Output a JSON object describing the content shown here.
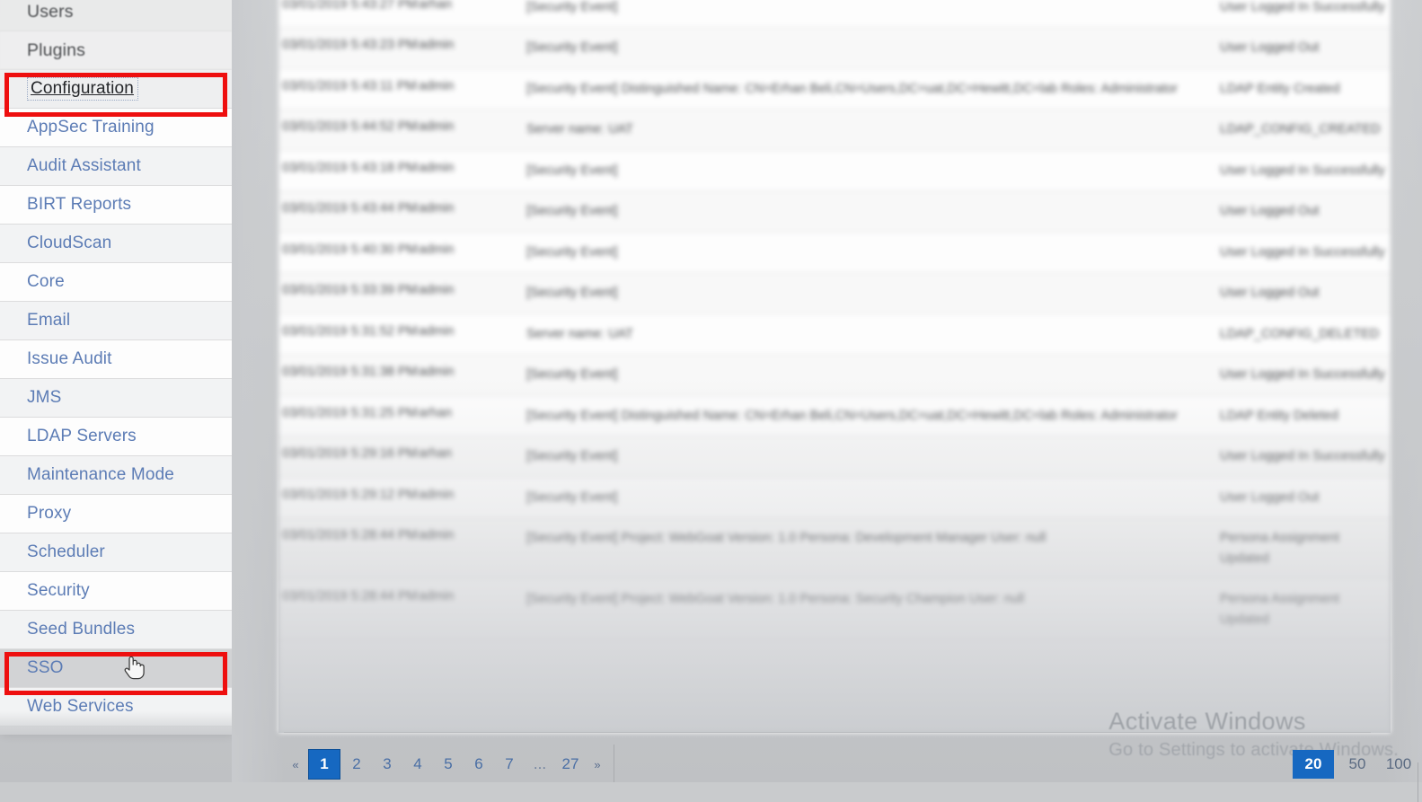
{
  "sidebar": {
    "items": [
      {
        "label": "Users",
        "kind": "header"
      },
      {
        "label": "Plugins",
        "kind": "header"
      },
      {
        "label": "Configuration",
        "kind": "current"
      },
      {
        "label": "AppSec Training",
        "kind": "link"
      },
      {
        "label": "Audit Assistant",
        "kind": "link"
      },
      {
        "label": "BIRT Reports",
        "kind": "link"
      },
      {
        "label": "CloudScan",
        "kind": "link"
      },
      {
        "label": "Core",
        "kind": "link"
      },
      {
        "label": "Email",
        "kind": "link"
      },
      {
        "label": "Issue Audit",
        "kind": "link"
      },
      {
        "label": "JMS",
        "kind": "link"
      },
      {
        "label": "LDAP Servers",
        "kind": "link"
      },
      {
        "label": "Maintenance Mode",
        "kind": "link"
      },
      {
        "label": "Proxy",
        "kind": "link"
      },
      {
        "label": "Scheduler",
        "kind": "link"
      },
      {
        "label": "Security",
        "kind": "link"
      },
      {
        "label": "Seed Bundles",
        "kind": "link"
      },
      {
        "label": "SSO",
        "kind": "hovered"
      },
      {
        "label": "Web Services",
        "kind": "link"
      }
    ]
  },
  "annotations": {
    "highlight_color": "#ee0f0f",
    "boxes": [
      "Configuration",
      "SSO"
    ]
  },
  "audit_table": {
    "rows": [
      {
        "date": "03/01/2019 5:43:27 PM",
        "user": "arhan",
        "description": "[Security Event]",
        "type": "User Logged In Successfully"
      },
      {
        "date": "03/01/2019 5:43:23 PM",
        "user": "admin",
        "description": "[Security Event]",
        "type": "User Logged Out"
      },
      {
        "date": "03/01/2019 5:43:11 PM",
        "user": "admin",
        "description": "[Security Event] Distinguished Name: CN=Erhan Beli,CN=Users,DC=uat,DC=Hewitt,DC=lab Roles: Administrator",
        "type": "LDAP Entity Created"
      },
      {
        "date": "03/01/2019 5:44:52 PM",
        "user": "admin",
        "description": "Server name: UAT",
        "type": "LDAP_CONFIG_CREATED"
      },
      {
        "date": "03/01/2019 5:43:18 PM",
        "user": "admin",
        "description": "[Security Event]",
        "type": "User Logged In Successfully"
      },
      {
        "date": "03/01/2019 5:43:44 PM",
        "user": "admin",
        "description": "[Security Event]",
        "type": "User Logged Out"
      },
      {
        "date": "03/01/2019 5:40:30 PM",
        "user": "admin",
        "description": "[Security Event]",
        "type": "User Logged In Successfully"
      },
      {
        "date": "03/01/2019 5:33:39 PM",
        "user": "admin",
        "description": "[Security Event]",
        "type": "User Logged Out"
      },
      {
        "date": "03/01/2019 5:31:52 PM",
        "user": "admin",
        "description": "Server name: UAT",
        "type": "LDAP_CONFIG_DELETED"
      },
      {
        "date": "03/01/2019 5:31:38 PM",
        "user": "admin",
        "description": "[Security Event]",
        "type": "User Logged In Successfully"
      },
      {
        "date": "03/01/2019 5:31:25 PM",
        "user": "arhan",
        "description": "[Security Event] Distinguished Name: CN=Erhan Beli,CN=Users,DC=uat,DC=Hewitt,DC=lab Roles: Administrator",
        "type": "LDAP Entity Deleted"
      },
      {
        "date": "03/01/2019 5:29:16 PM",
        "user": "arhan",
        "description": "[Security Event]",
        "type": "User Logged In Successfully"
      },
      {
        "date": "03/01/2019 5:29:12 PM",
        "user": "admin",
        "description": "[Security Event]",
        "type": "User Logged Out"
      },
      {
        "date": "03/01/2019 5:28:44 PM",
        "user": "admin",
        "description": "[Security Event] Project: WebGoat Version: 1.0 Persona: Development Manager User: null",
        "type": "Persona Assignment Updated"
      },
      {
        "date": "03/01/2019 5:28:44 PM",
        "user": "admin",
        "description": "[Security Event] Project: WebGoat Version: 1.0 Persona: Security Champion User: null",
        "type": "Persona Assignment Updated"
      }
    ]
  },
  "pagination": {
    "prev_label": "«",
    "next_label": "»",
    "pages": [
      "1",
      "2",
      "3",
      "4",
      "5",
      "6",
      "7",
      "...",
      "27"
    ],
    "active_page": "1",
    "ellipsis": "...",
    "page_sizes": [
      "20",
      "50",
      "100"
    ],
    "active_page_size": "20",
    "accent_color": "#1668c1"
  },
  "watermark": {
    "title": "Activate Windows",
    "subtitle": "Go to Settings to activate Windows."
  }
}
